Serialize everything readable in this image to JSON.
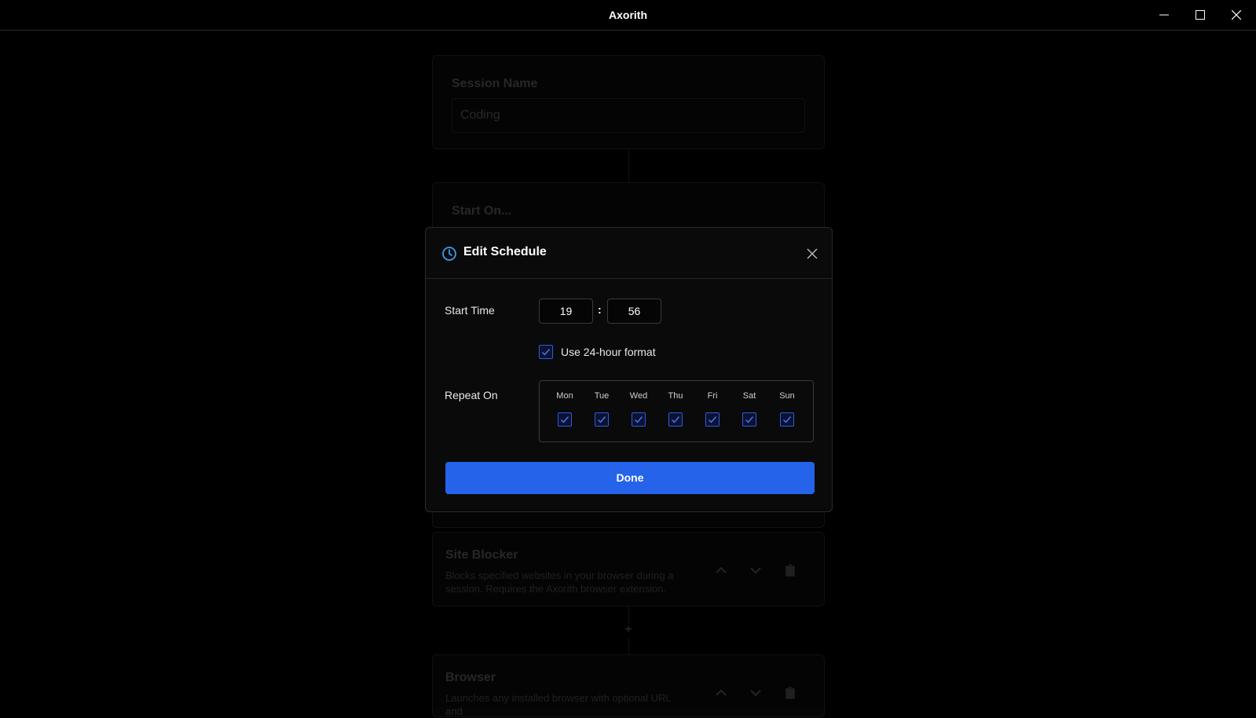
{
  "window": {
    "title": "Axorith"
  },
  "background": {
    "session_name": {
      "label": "Session Name",
      "value": "Coding"
    },
    "start_on": {
      "label": "Start On..."
    },
    "modules": [
      {
        "title": "Site Blocker",
        "description": "Blocks specified websites in your browser during a session. Requires the Axorith browser extension."
      },
      {
        "title": "Browser",
        "description": "Launches any installed browser with optional URL and"
      }
    ],
    "add_symbol": "+"
  },
  "modal": {
    "title": "Edit Schedule",
    "icon": "clock-icon",
    "start_time": {
      "label": "Start Time",
      "hour": "19",
      "minute": "56",
      "separator": ":"
    },
    "use_24h": {
      "label": "Use 24-hour format",
      "checked": true
    },
    "repeat_on": {
      "label": "Repeat On",
      "days": [
        {
          "name": "Mon",
          "checked": true
        },
        {
          "name": "Tue",
          "checked": true
        },
        {
          "name": "Wed",
          "checked": true
        },
        {
          "name": "Thu",
          "checked": true
        },
        {
          "name": "Fri",
          "checked": true
        },
        {
          "name": "Sat",
          "checked": true
        },
        {
          "name": "Sun",
          "checked": true
        }
      ]
    },
    "done_label": "Done"
  },
  "colors": {
    "accent": "#2563eb",
    "check_border": "#2f5be0",
    "clock": "#3b9cf0"
  }
}
